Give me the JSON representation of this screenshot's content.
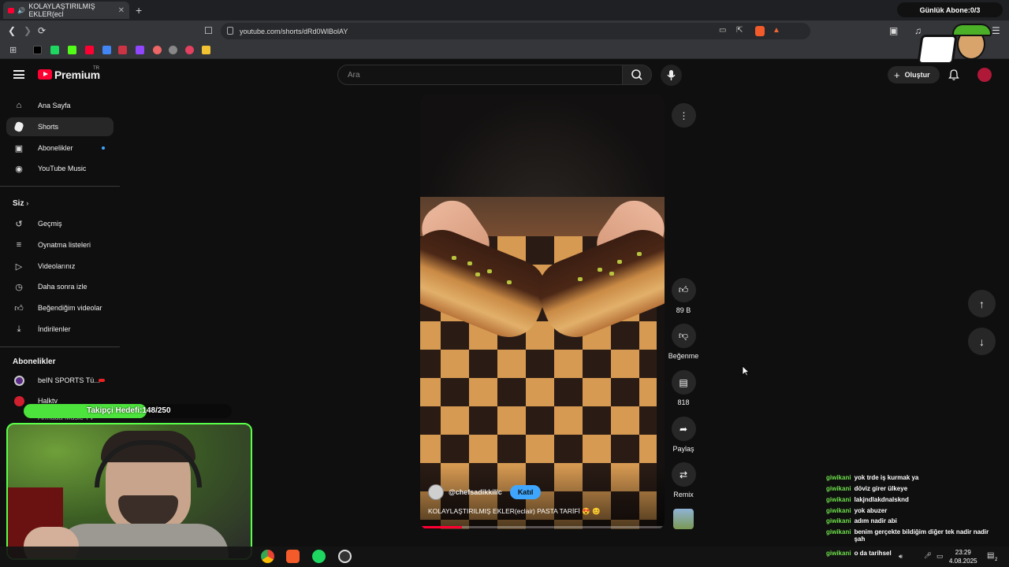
{
  "browser": {
    "tab_title": "KOLAYLAŞTIRILMIŞ EKLER(ecl",
    "url": "youtube.com/shorts/dRd0WlBolAY",
    "top_goal": "Günlük Abone:0/3"
  },
  "header": {
    "logo_text": "Premium",
    "logo_badge": "TR",
    "search_placeholder": "Ara",
    "create_label": "Oluştur"
  },
  "sidebar": {
    "main": [
      {
        "label": "Ana Sayfa",
        "icon": "home-icon"
      },
      {
        "label": "Shorts",
        "icon": "shorts-icon"
      },
      {
        "label": "Abonelikler",
        "icon": "subscriptions-icon"
      },
      {
        "label": "YouTube Music",
        "icon": "youtube-music-icon"
      }
    ],
    "you_heading": "Siz",
    "you": [
      {
        "label": "Geçmiş",
        "icon": "history-icon"
      },
      {
        "label": "Oynatma listeleri",
        "icon": "playlists-icon"
      },
      {
        "label": "Videolarınız",
        "icon": "your-videos-icon"
      },
      {
        "label": "Daha sonra izle",
        "icon": "watch-later-icon"
      },
      {
        "label": "Beğendiğim videolar",
        "icon": "liked-icon"
      },
      {
        "label": "İndirilenler",
        "icon": "downloads-icon"
      }
    ],
    "subs_heading": "Abonelikler",
    "subs": [
      {
        "label": "beIN SPORTS Tü..."
      },
      {
        "label": "Halktv"
      },
      {
        "label": "Armada Music TV"
      }
    ]
  },
  "video": {
    "channel": "@chefsadikkilic",
    "join_label": "Katıl",
    "title": "KOLAYLAŞTIRILMIŞ EKLER(eclair) PASTA TARİFİ 😍 😊",
    "progress": 0.17
  },
  "actions": {
    "likes": "89 B",
    "dislike_label": "Beğenme",
    "comments": "818",
    "share_label": "Paylaş",
    "remix_label": "Remix"
  },
  "overlay": {
    "follow_goal": "Takipçi Hedefi:148/250",
    "follow_progress": 0.592
  },
  "chat": [
    {
      "user": "giwikani",
      "msg": "yok trde iş kurmak ya"
    },
    {
      "user": "giwikani",
      "msg": "döviz girer ülkeye"
    },
    {
      "user": "giwikani",
      "msg": "lakjndlakdnalsknd"
    },
    {
      "user": "giwikani",
      "msg": "yok abuzer"
    },
    {
      "user": "giwikani",
      "msg": "adım nadir abi"
    },
    {
      "user": "giwikani",
      "msg": "benim gerçekte bildiğim diğer tek nadir nadir şah"
    },
    {
      "user": "giwikani",
      "msg": "o da tarihsel"
    }
  ],
  "taskbar": {
    "time": "23:29",
    "date": "4.08.2025",
    "notif_count": "2"
  },
  "colors": {
    "accent": "#ff0033",
    "join": "#3ea6ff",
    "goal": "#4ce33c",
    "chat_user": "#6ee04b"
  }
}
